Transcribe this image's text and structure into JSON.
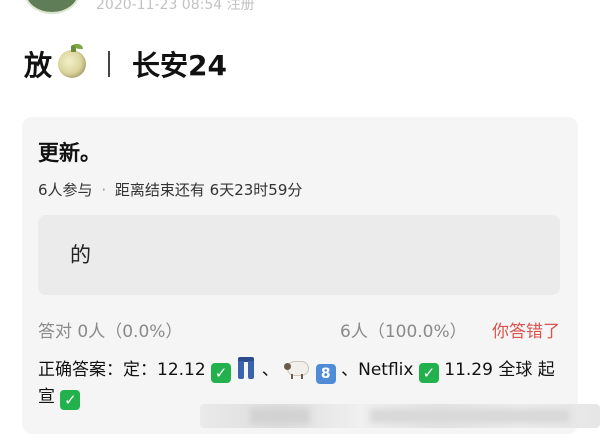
{
  "header": {
    "meta": "2020-11-23 08:54 注册"
  },
  "post": {
    "title_prefix": "放",
    "title_suffix": "长安24"
  },
  "poll": {
    "title": "更新。",
    "participants": "6人参与",
    "separator": "·",
    "deadline": "距离结束还有 6天23时59分",
    "option": "的",
    "correct_label": "答对 0人（0.0%）",
    "count_label": "6人（100.0%）",
    "status": "你答错了",
    "answer": {
      "prefix": "正确答案：定：12.12",
      "sep1": "、",
      "sep2": "、Netflix",
      "part3": "11.29 全球",
      "part4": "起宣"
    },
    "keycap_digit": "8"
  },
  "icons": {
    "melon": "melon-icon",
    "check": "check-mark-icon",
    "jeans": "jeans-icon",
    "sheep": "sheep-icon",
    "keycap": "keycap-8-icon"
  },
  "colors": {
    "status_red": "#d9534f",
    "check_green": "#22b14c",
    "card_bg": "#f5f5f5"
  }
}
